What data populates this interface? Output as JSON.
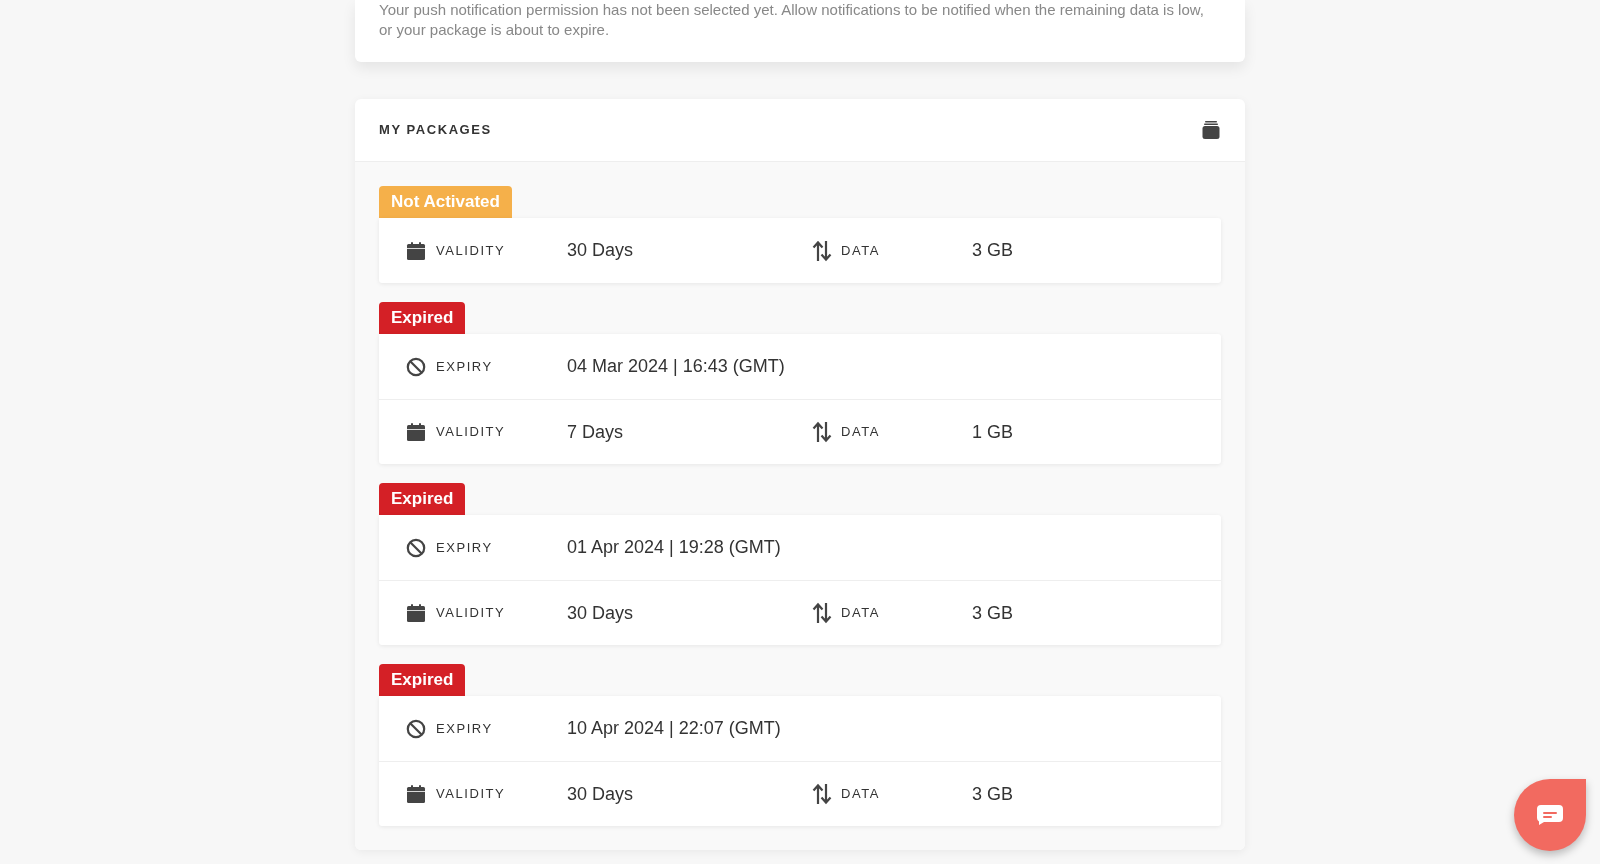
{
  "notice": {
    "text": "Your push notification permission has not been selected yet. Allow notifications to be notified when the remaining data is low, or your package is about to expire."
  },
  "packages_card": {
    "title": "MY PACKAGES",
    "packages": [
      {
        "status": {
          "label": "Not Activated",
          "kind": "not_activated"
        },
        "rows": [
          {
            "kind": "validity",
            "label": "VALIDITY",
            "value": "30 Days",
            "data_label": "DATA",
            "data_value": "3 GB"
          }
        ]
      },
      {
        "status": {
          "label": "Expired",
          "kind": "expired"
        },
        "rows": [
          {
            "kind": "expiry",
            "label": "EXPIRY",
            "value": "04 Mar 2024 | 16:43 (GMT)"
          },
          {
            "kind": "validity",
            "label": "VALIDITY",
            "value": "7 Days",
            "data_label": "DATA",
            "data_value": "1 GB"
          }
        ]
      },
      {
        "status": {
          "label": "Expired",
          "kind": "expired"
        },
        "rows": [
          {
            "kind": "expiry",
            "label": "EXPIRY",
            "value": "01 Apr 2024 | 19:28 (GMT)"
          },
          {
            "kind": "validity",
            "label": "VALIDITY",
            "value": "30 Days",
            "data_label": "DATA",
            "data_value": "3 GB"
          }
        ]
      },
      {
        "status": {
          "label": "Expired",
          "kind": "expired"
        },
        "rows": [
          {
            "kind": "expiry",
            "label": "EXPIRY",
            "value": "10 Apr 2024 | 22:07 (GMT)"
          },
          {
            "kind": "validity",
            "label": "VALIDITY",
            "value": "30 Days",
            "data_label": "DATA",
            "data_value": "3 GB"
          }
        ]
      }
    ]
  }
}
